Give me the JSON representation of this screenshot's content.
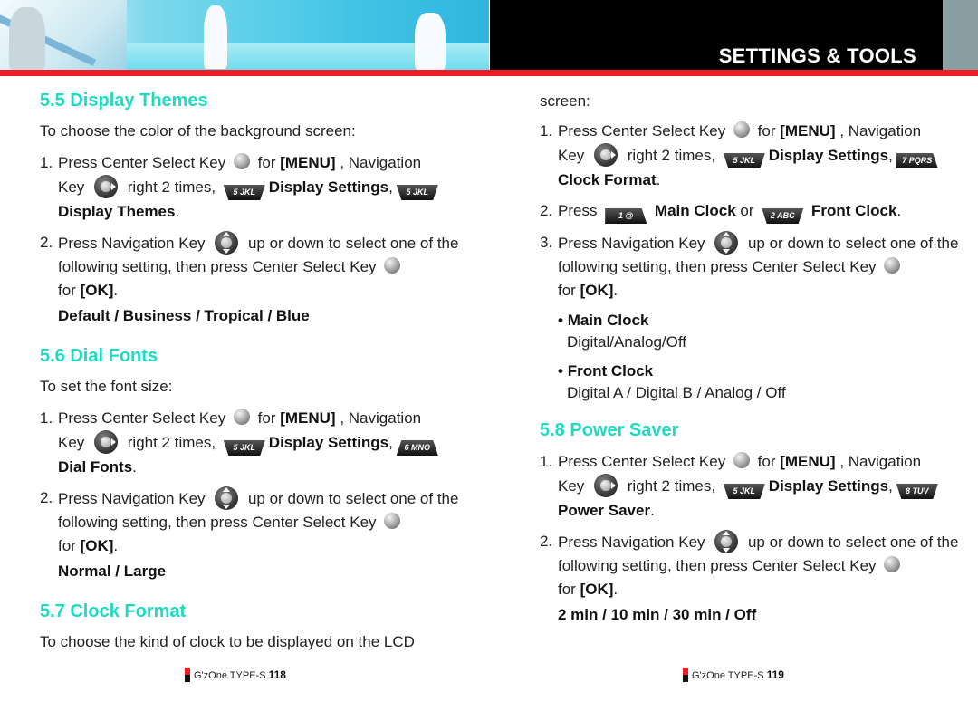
{
  "header": {
    "title": "SETTINGS & TOOLS"
  },
  "colors": {
    "heading": "#1ddbc2",
    "accent_red": "#ee1c25",
    "banner_black": "#000000",
    "banner_grey": "#8a9fa3"
  },
  "left": {
    "s55": {
      "title": "5.5 Display Themes",
      "intro": "To choose the color of the background screen:",
      "step1": {
        "num": "1.",
        "a": "Press Center Select Key",
        "b": "for",
        "menu": "[MENU]",
        "c": ", Navigation",
        "d": "Key",
        "e": "right 2 times,",
        "k1": "5 JKL",
        "ds": "Display Settings",
        "comma": ",",
        "k2": "5 JKL",
        "target": "Display Themes",
        "dot": "."
      },
      "step2": {
        "num": "2.",
        "a": "Press Navigation Key",
        "b": "up or down to select one of the following setting, then press Center Select Key",
        "c": "for",
        "ok": "[OK]",
        "dot": "."
      },
      "options": "Default / Business / Tropical / Blue"
    },
    "s56": {
      "title": "5.6 Dial Fonts",
      "intro": "To set the font size:",
      "step1": {
        "num": "1.",
        "a": "Press Center Select Key",
        "b": "for",
        "menu": "[MENU]",
        "c": ", Navigation",
        "d": "Key",
        "e": "right 2 times,",
        "k1": "5 JKL",
        "ds": "Display Settings",
        "comma": ",",
        "k2": "6 MNO",
        "target": "Dial Fonts",
        "dot": "."
      },
      "step2": {
        "num": "2.",
        "a": "Press Navigation Key",
        "b": "up or down to select one of the following setting, then press Center Select Key",
        "c": "for",
        "ok": "[OK]",
        "dot": "."
      },
      "options": "Normal / Large"
    },
    "s57": {
      "title": "5.7 Clock Format",
      "intro": "To choose the kind of clock to be displayed on the LCD"
    },
    "footer": {
      "brand": "G'zOne TYPE-S",
      "page": "118"
    }
  },
  "right": {
    "cont": "screen:",
    "s57": {
      "step1": {
        "num": "1.",
        "a": "Press Center Select Key",
        "b": "for",
        "menu": "[MENU]",
        "c": ", Navigation",
        "d": "Key",
        "e": "right 2 times,",
        "k1": "5 JKL",
        "ds": "Display Settings",
        "comma": ",",
        "k2": "7 PQRS",
        "target": "Clock Format",
        "dot": "."
      },
      "step2": {
        "num": "2.",
        "a": "Press",
        "k1": "1 @",
        "main": "Main Clock",
        "or": "or",
        "k2": "2 ABC",
        "front": "Front Clock",
        "dot": "."
      },
      "step3": {
        "num": "3.",
        "a": "Press Navigation Key",
        "b": "up or down to select one of the following setting, then press Center Select Key",
        "c": "for",
        "ok": "[OK]",
        "dot": "."
      },
      "bullets": [
        {
          "title": "Main Clock",
          "value": "Digital/Analog/Off"
        },
        {
          "title": "Front Clock",
          "value": "Digital A / Digital B / Analog / Off"
        }
      ]
    },
    "s58": {
      "title": "5.8 Power Saver",
      "step1": {
        "num": "1.",
        "a": "Press Center Select Key",
        "b": "for",
        "menu": "[MENU]",
        "c": ", Navigation",
        "d": "Key",
        "e": "right 2 times,",
        "k1": "5 JKL",
        "ds": "Display Settings",
        "comma": ",",
        "k2": "8 TUV",
        "target": "Power Saver",
        "dot": "."
      },
      "step2": {
        "num": "2.",
        "a": "Press Navigation Key",
        "b": "up or down to select one of the following setting, then press Center Select Key",
        "c": "for",
        "ok": "[OK]",
        "dot": "."
      },
      "options": "2 min / 10 min / 30 min / Off"
    },
    "footer": {
      "brand": "G'zOne TYPE-S",
      "page": "119"
    }
  }
}
